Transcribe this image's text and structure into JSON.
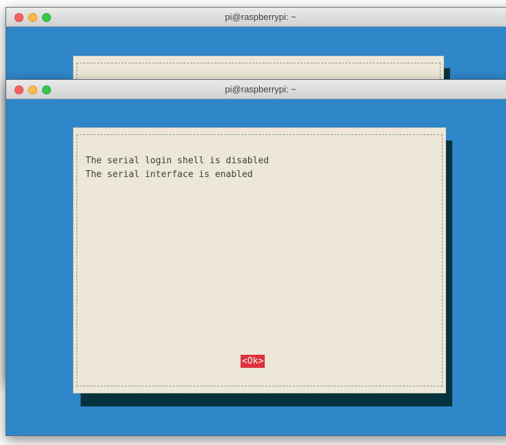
{
  "back_window": {
    "title": "pi@raspberrypi: ~",
    "colors": {
      "terminal_bg": "#2f86c9",
      "dialog_bg": "#ece7d6"
    }
  },
  "front_window": {
    "title": "pi@raspberrypi: ~",
    "dialog": {
      "lines": [
        "The serial login shell is disabled",
        "The serial interface is enabled"
      ],
      "ok_label": "<Ok>"
    },
    "colors": {
      "terminal_bg": "#2f86c9",
      "dialog_bg": "#ece7d6",
      "dialog_shadow": "#05343f",
      "ok_button_bg": "#e1303b"
    }
  },
  "icons": [
    "close-icon",
    "minimize-icon",
    "zoom-icon"
  ]
}
